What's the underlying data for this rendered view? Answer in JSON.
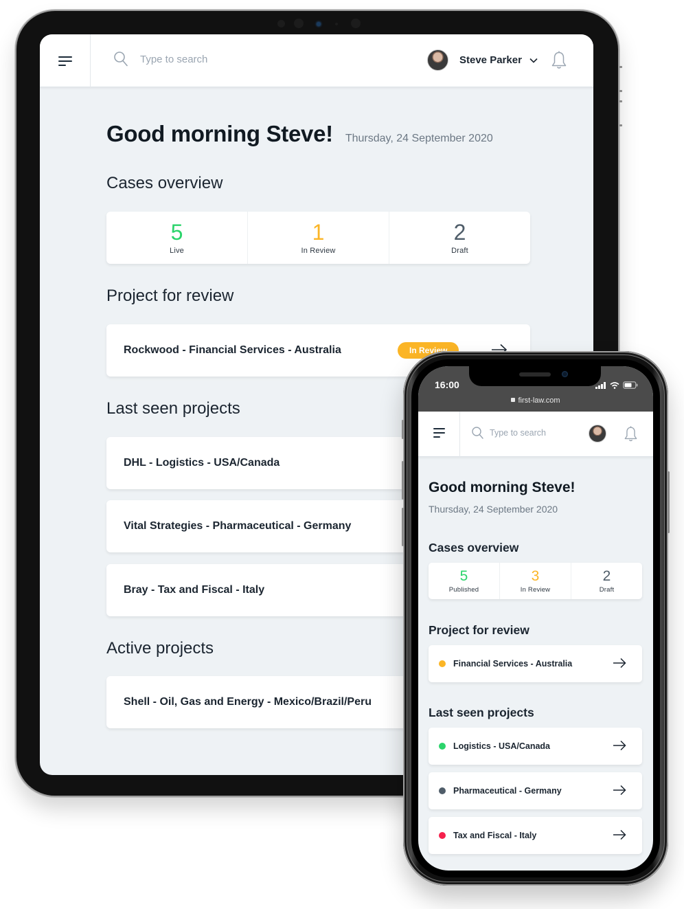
{
  "colors": {
    "live": "#2bd46b",
    "review": "#fbb526",
    "draft": "#4f5d69",
    "danger": "#f5204c"
  },
  "tablet": {
    "header": {
      "search_placeholder": "Type to search",
      "user_name": "Steve Parker"
    },
    "greeting": "Good morning Steve!",
    "date": "Thursday, 24 September 2020",
    "cases_title": "Cases overview",
    "cases": [
      {
        "value": "5",
        "label": "Live",
        "status": "live"
      },
      {
        "value": "1",
        "label": "In Review",
        "status": "review"
      },
      {
        "value": "2",
        "label": "Draft",
        "status": "draft"
      }
    ],
    "review_title": "Project for review",
    "review_projects": [
      {
        "name": "Rockwood - Financial Services - Australia",
        "badge": "In Review"
      }
    ],
    "last_seen_title": "Last seen projects",
    "last_seen": [
      {
        "name": "DHL - Logistics - USA/Canada"
      },
      {
        "name": "Vital Strategies - Pharmaceutical - Germany"
      },
      {
        "name": "Bray - Tax and Fiscal - Italy"
      }
    ],
    "active_title": "Active projects",
    "active": [
      {
        "name": "Shell - Oil, Gas and Energy - Mexico/Brazil/Peru"
      }
    ]
  },
  "phone": {
    "status": {
      "time": "16:00",
      "url": "first-law.com"
    },
    "header": {
      "search_placeholder": "Type to search"
    },
    "greeting": "Good morning Steve!",
    "date": "Thursday, 24 September 2020",
    "cases_title": "Cases overview",
    "cases": [
      {
        "value": "5",
        "label": "Published",
        "status": "live"
      },
      {
        "value": "3",
        "label": "In Review",
        "status": "review"
      },
      {
        "value": "2",
        "label": "Draft",
        "status": "draft"
      }
    ],
    "review_title": "Project for review",
    "review_projects": [
      {
        "name": "Financial Services - Australia",
        "dot": "review"
      }
    ],
    "last_seen_title": "Last seen projects",
    "last_seen": [
      {
        "name": "Logistics - USA/Canada",
        "dot": "live"
      },
      {
        "name": "Pharmaceutical - Germany",
        "dot": "draft"
      },
      {
        "name": "Tax and Fiscal - Italy",
        "dot": "danger"
      }
    ]
  }
}
